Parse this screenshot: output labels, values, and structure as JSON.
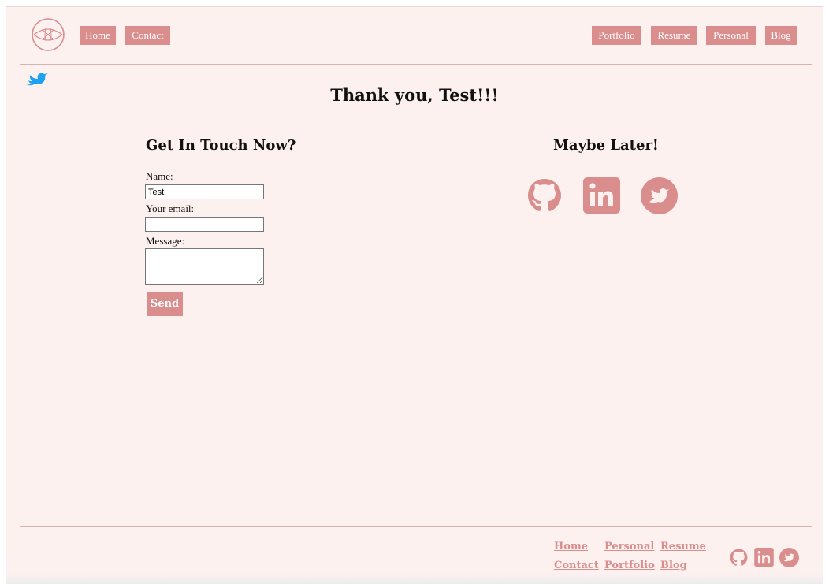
{
  "header": {
    "nav_left": [
      "Home",
      "Contact"
    ],
    "nav_right": [
      "Portfolio",
      "Resume",
      "Personal",
      "Blog"
    ]
  },
  "main": {
    "title": "Thank you, Test!!!",
    "contact_form": {
      "heading": "Get In Touch Now?",
      "name_label": "Name:",
      "name_value": "Test",
      "email_label": "Your email:",
      "email_value": "",
      "message_label": "Message:",
      "message_value": "",
      "send_label": "Send"
    },
    "later": {
      "heading": "Maybe Later!",
      "icons": [
        "github-icon",
        "linkedin-icon",
        "twitter-icon"
      ]
    }
  },
  "footer": {
    "links": [
      "Home",
      "Personal",
      "Resume",
      "Contact",
      "Portfolio",
      "Blog"
    ],
    "icons": [
      "github-icon",
      "linkedin-icon",
      "twitter-icon"
    ]
  },
  "colors": {
    "accent": "#d98d8d",
    "background": "#fdf1f0",
    "twitter_bird": "#1da1f2"
  }
}
